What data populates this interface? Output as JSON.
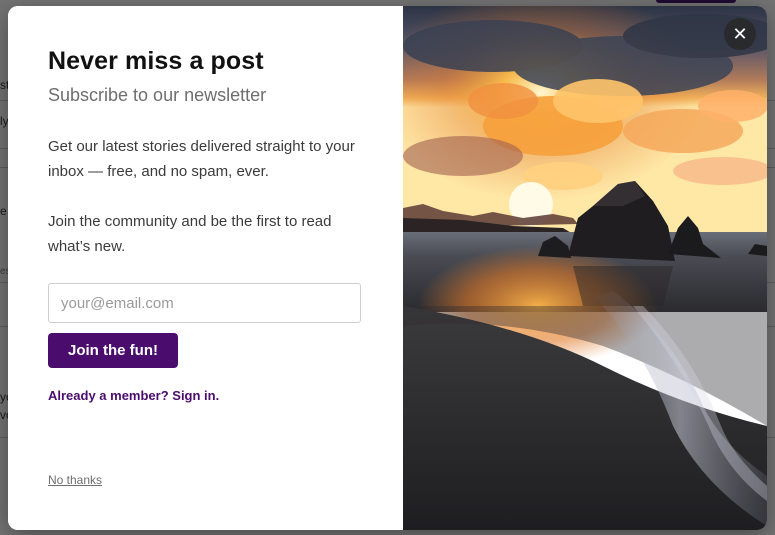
{
  "background": {
    "edge_chars": [
      "st",
      "ly",
      "e",
      "es",
      "yo",
      "vo"
    ]
  },
  "modal": {
    "title": "Never miss a post",
    "subtitle": "Subscribe to our newsletter",
    "paragraph1": "Get our latest stories delivered straight to your inbox — free, and no spam, ever.",
    "paragraph2": "Join the community and be the first to read what’s new.",
    "email_placeholder": "your@email.com",
    "email_value": "",
    "join_button_label": "Join the fun!",
    "signin_link_label": "Already a member? Sign in.",
    "no_thanks_label": "No thanks",
    "close_icon_glyph": "✕",
    "accent_color": "#4a0d6e"
  },
  "hero_image": {
    "subject": "sunset over rocky beach with waves"
  }
}
